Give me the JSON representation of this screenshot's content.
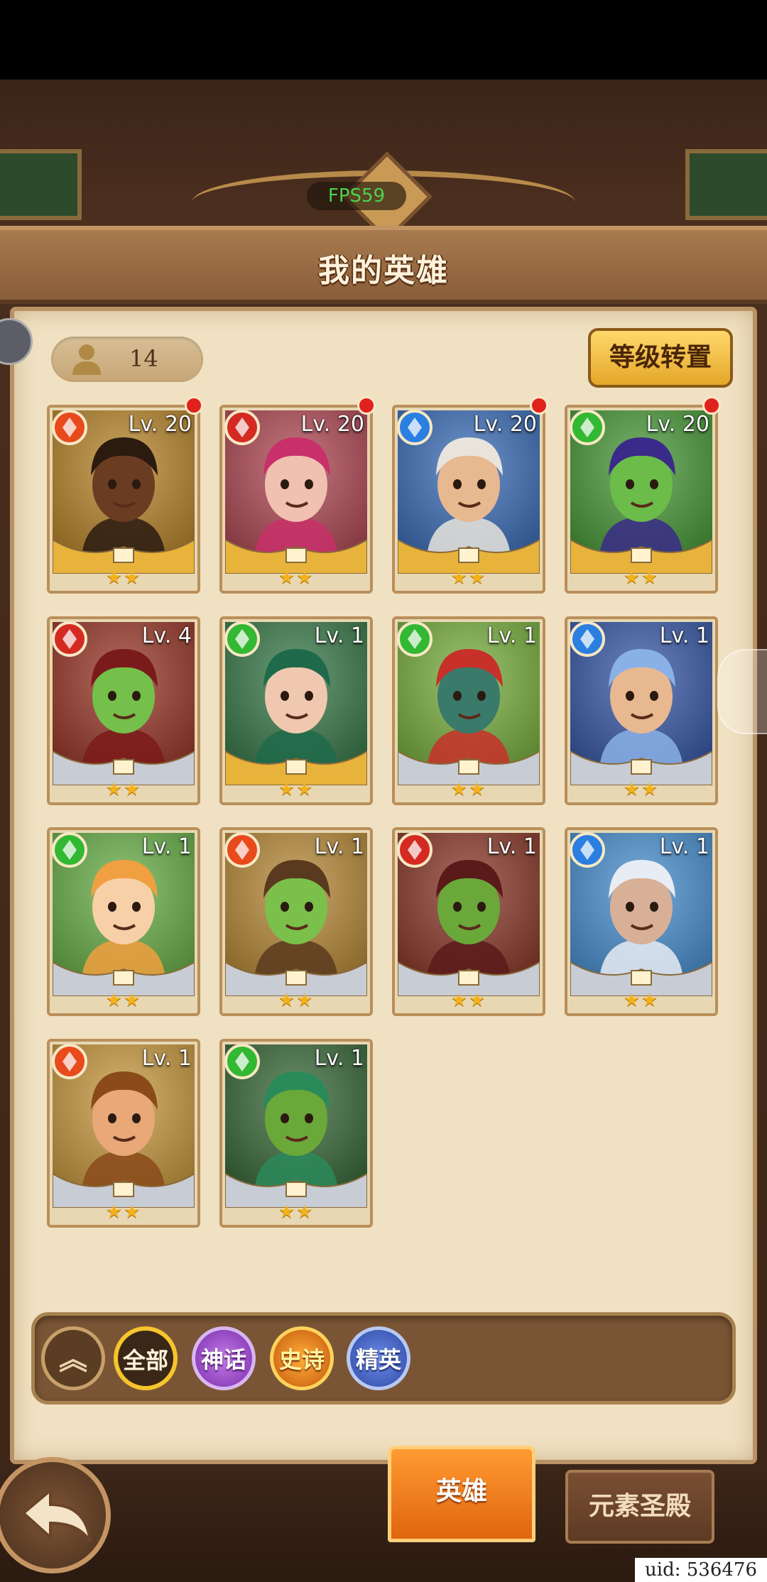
{
  "overlay": {
    "fps": "FPS59"
  },
  "header": {
    "title": "我的英雄"
  },
  "toolbar": {
    "hero_count": "14",
    "convert_button": "等级转置"
  },
  "colors": {
    "fire": "#e84a1c",
    "red": "#d42a22",
    "water": "#2a7fe0",
    "wind": "#32b832",
    "gold_frame": "#e8b33a",
    "silver_frame": "#c8ccd4"
  },
  "heroes": [
    {
      "level": "Lv. 20",
      "element": "fire",
      "frame": "gold",
      "stars": "★★",
      "notify": true,
      "bg": "#b8862c",
      "skin": "#6a3c22",
      "hair": "#2a1a10"
    },
    {
      "level": "Lv. 20",
      "element": "red",
      "frame": "gold",
      "stars": "★★",
      "notify": true,
      "bg": "#b04a55",
      "skin": "#f0c0b0",
      "hair": "#c8306a"
    },
    {
      "level": "Lv. 20",
      "element": "water",
      "frame": "gold",
      "stars": "★★",
      "notify": true,
      "bg": "#3d6fb8",
      "skin": "#e8b890",
      "hair": "#e8e4dc"
    },
    {
      "level": "Lv. 20",
      "element": "wind",
      "frame": "gold",
      "stars": "★★",
      "notify": true,
      "bg": "#4a9a3a",
      "skin": "#6cbc4a",
      "hair": "#3a2a8a"
    },
    {
      "level": "Lv. 4",
      "element": "red",
      "frame": "silver",
      "stars": "★★",
      "notify": false,
      "bg": "#9a3a2a",
      "skin": "#74c04a",
      "hair": "#7a1a1a"
    },
    {
      "level": "Lv. 1",
      "element": "wind",
      "frame": "gold",
      "stars": "★★",
      "notify": false,
      "bg": "#3a7a4a",
      "skin": "#f0c8b0",
      "hair": "#1e6a4a"
    },
    {
      "level": "Lv. 1",
      "element": "wind",
      "frame": "silver",
      "stars": "★★",
      "notify": false,
      "bg": "#7ab040",
      "skin": "#3a7a6a",
      "hair": "#c8302a"
    },
    {
      "level": "Lv. 1",
      "element": "water",
      "frame": "silver",
      "stars": "★★",
      "notify": false,
      "bg": "#3a5aa8",
      "skin": "#e8b890",
      "hair": "#8ab0e8"
    },
    {
      "level": "Lv. 1",
      "element": "wind",
      "frame": "silver",
      "stars": "★★",
      "notify": false,
      "bg": "#6ab04a",
      "skin": "#f8d0a8",
      "hair": "#f0a040"
    },
    {
      "level": "Lv. 1",
      "element": "fire",
      "frame": "silver",
      "stars": "★★",
      "notify": false,
      "bg": "#b88a3a",
      "skin": "#7ac04a",
      "hair": "#5a3a1e"
    },
    {
      "level": "Lv. 1",
      "element": "red",
      "frame": "silver",
      "stars": "★★",
      "notify": false,
      "bg": "#8a3a2a",
      "skin": "#6aa83a",
      "hair": "#5a1a1a"
    },
    {
      "level": "Lv. 1",
      "element": "water",
      "frame": "silver",
      "stars": "★★",
      "notify": false,
      "bg": "#4a90d0",
      "skin": "#d8b098",
      "hair": "#e8ecf4"
    },
    {
      "level": "Lv. 1",
      "element": "fire",
      "frame": "silver",
      "stars": "★★",
      "notify": false,
      "bg": "#c89a40",
      "skin": "#e8a878",
      "hair": "#8a4a1a"
    },
    {
      "level": "Lv. 1",
      "element": "wind",
      "frame": "silver",
      "stars": "★★",
      "notify": false,
      "bg": "#3a6a3a",
      "skin": "#6aa83a",
      "hair": "#2a8a5a"
    }
  ],
  "filters": {
    "all": "全部",
    "myth": "神话",
    "epic": "史诗",
    "elite": "精英"
  },
  "tabs": {
    "heroes": "英雄",
    "shrine": "元素圣殿"
  },
  "footer": {
    "uid": "uid: 536476"
  }
}
